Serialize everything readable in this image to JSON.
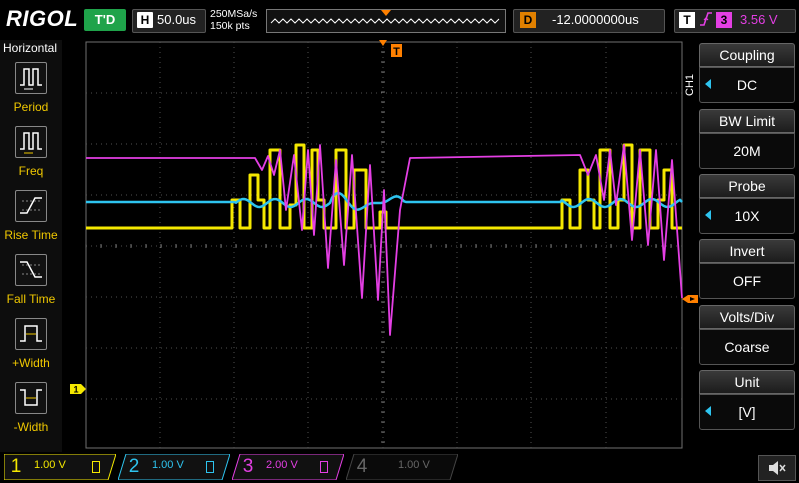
{
  "header": {
    "logo": "RIGOL",
    "run_status": "T'D",
    "timebase_letter": "H",
    "timebase": "50.0us",
    "sample_rate": "250MSa/s",
    "memory_depth": "150k pts",
    "delay_letter": "D",
    "delay": "-12.0000000us",
    "trigger_letter": "T",
    "trigger_edge_icon": "rising-edge-icon",
    "trigger_source": "3",
    "trigger_level": "3.56 V"
  },
  "left_menu": {
    "title": "Horizontal",
    "items": [
      {
        "label": "Period",
        "icon": "period-icon"
      },
      {
        "label": "Freq",
        "icon": "frequency-icon"
      },
      {
        "label": "Rise Time",
        "icon": "rise-time-icon"
      },
      {
        "label": "Fall Time",
        "icon": "fall-time-icon"
      },
      {
        "label": "+Width",
        "icon": "positive-width-icon"
      },
      {
        "label": "-Width",
        "icon": "negative-width-icon"
      }
    ]
  },
  "right_menu": {
    "channel_tab": "CH1",
    "items": [
      {
        "title": "Coupling",
        "value": "DC",
        "has_arrow": true
      },
      {
        "title": "BW Limit",
        "value": "20M",
        "has_arrow": false
      },
      {
        "title": "Probe",
        "value": "10X",
        "has_arrow": true
      },
      {
        "title": "Invert",
        "value": "OFF",
        "has_arrow": false
      },
      {
        "title": "Volts/Div",
        "value": "Coarse",
        "has_arrow": false
      },
      {
        "title": "Unit",
        "value": "[V]",
        "has_arrow": true
      }
    ]
  },
  "channels": [
    {
      "number": "1",
      "scale": "1.00 V",
      "color": "#f5e800",
      "active": true
    },
    {
      "number": "2",
      "scale": "1.00 V",
      "color": "#2ec4ef",
      "active": true
    },
    {
      "number": "3",
      "scale": "2.00 V",
      "color": "#e43fe4",
      "active": true
    },
    {
      "number": "4",
      "scale": "1.00 V",
      "color": "#666666",
      "active": false
    }
  ],
  "markers": {
    "trigger_position_label": "T",
    "ch1_ground_label": "1"
  },
  "colors": {
    "ch1": "#f5e800",
    "ch2": "#2ec4ef",
    "ch3": "#e43fe4",
    "trigger": "#ff8000",
    "grid": "#505050",
    "status_green": "#1fa34a"
  }
}
